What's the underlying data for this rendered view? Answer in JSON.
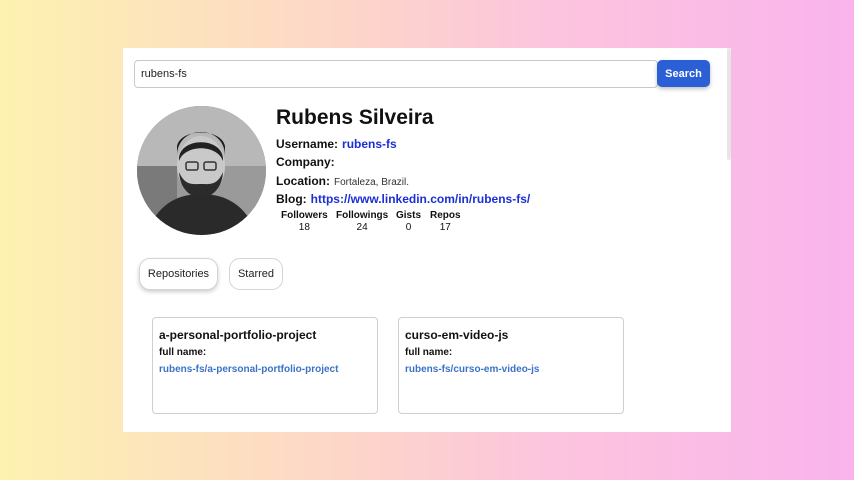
{
  "search": {
    "value": "rubens-fs",
    "button_label": "Search"
  },
  "profile": {
    "name": "Rubens Silveira",
    "username_label": "Username:",
    "username": "rubens-fs",
    "company_label": "Company:",
    "company": "",
    "location_label": "Location:",
    "location": "Fortaleza, Brazil.",
    "blog_label": "Blog:",
    "blog": "https://www.linkedin.com/in/rubens-fs/"
  },
  "stats": [
    {
      "label": "Followers",
      "value": "18"
    },
    {
      "label": "Followings",
      "value": "24"
    },
    {
      "label": "Gists",
      "value": "0"
    },
    {
      "label": "Repos",
      "value": "17"
    }
  ],
  "tabs": [
    {
      "label": "Repositories",
      "active": true
    },
    {
      "label": "Starred",
      "active": false
    }
  ],
  "repos": [
    {
      "name": "a-personal-portfolio-project",
      "full_name_label": "full name:",
      "full_name": "rubens-fs/a-personal-portfolio-project"
    },
    {
      "name": "curso-em-video-js",
      "full_name_label": "full name:",
      "full_name": "rubens-fs/curso-em-video-js"
    }
  ],
  "colors": {
    "accent": "#2a5fd6",
    "link": "#1a2fd6",
    "repo_link": "#3b72c8"
  }
}
